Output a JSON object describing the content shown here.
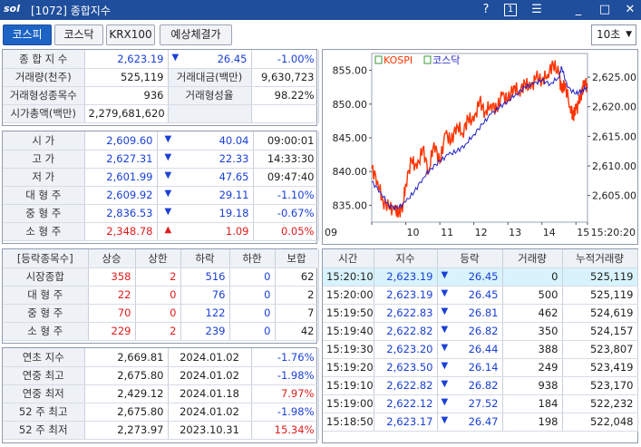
{
  "window": {
    "logo": "sol",
    "title": "[1072] 종합지수",
    "help": "?",
    "one": "1",
    "menu": "☰",
    "minimize": "_",
    "maximize": "□",
    "close": "✕"
  },
  "tabs": [
    {
      "label": "코스피",
      "active": true
    },
    {
      "label": "코스닥",
      "active": false
    },
    {
      "label": "KRX100",
      "active": false
    },
    {
      "label": "예상체결가",
      "active": false
    }
  ],
  "period": {
    "value": "10초",
    "arrow": "▼"
  },
  "summary": {
    "index_label": "종 합 지 수",
    "index_value": "2,623.19",
    "index_arrow": "▼",
    "index_change": "26.45",
    "index_rate": "-1.00%",
    "volume_label": "거래량(천주)",
    "volume_value": "525,119",
    "amount_label": "거래대금(백만)",
    "amount_value": "9,630,723",
    "formed_count_label": "거래형성종목수",
    "formed_count_value": "936",
    "formed_rate_label": "거래형성율",
    "formed_rate_value": "98.22%",
    "mcap_label": "시가총액(백만)",
    "mcap_value": "2,279,681,620"
  },
  "prices": [
    {
      "label": "시      가",
      "value": "2,609.60",
      "arrow": "▼",
      "change": "40.04",
      "extra": "09:00:01",
      "dir": "down",
      "extra_type": "time"
    },
    {
      "label": "고      가",
      "value": "2,627.31",
      "arrow": "▼",
      "change": "22.33",
      "extra": "14:33:30",
      "dir": "down",
      "extra_type": "time"
    },
    {
      "label": "저      가",
      "value": "2,601.99",
      "arrow": "▼",
      "change": "47.65",
      "extra": "09:47:40",
      "dir": "down",
      "extra_type": "time"
    },
    {
      "label": "대 형 주",
      "value": "2,609.92",
      "arrow": "▼",
      "change": "29.11",
      "extra": "-1.10%",
      "dir": "down",
      "extra_type": "rate"
    },
    {
      "label": "중 형 주",
      "value": "2,836.53",
      "arrow": "▼",
      "change": "19.18",
      "extra": "-0.67%",
      "dir": "down",
      "extra_type": "rate"
    },
    {
      "label": "소 형 주",
      "value": "2,348.78",
      "arrow": "▲",
      "change": "1.09",
      "extra": "0.05%",
      "dir": "up",
      "extra_type": "rate"
    }
  ],
  "breadth": {
    "headers": [
      "[등락종목수]",
      "상승",
      "상한",
      "하락",
      "하한",
      "보합"
    ],
    "rows": [
      {
        "label": "시장종합",
        "up": "358",
        "upper": "2",
        "down": "516",
        "lower": "0",
        "flat": "62"
      },
      {
        "label": "대 형 주",
        "up": "22",
        "upper": "0",
        "down": "76",
        "lower": "0",
        "flat": "2"
      },
      {
        "label": "중 형 주",
        "up": "70",
        "upper": "0",
        "down": "122",
        "lower": "0",
        "flat": "7"
      },
      {
        "label": "소 형 주",
        "up": "229",
        "upper": "2",
        "down": "239",
        "lower": "0",
        "flat": "42"
      }
    ]
  },
  "yearly": [
    {
      "label": "연초  지수",
      "value": "2,669.81",
      "date": "2024.01.02",
      "rate": "-1.76%",
      "dir": "down"
    },
    {
      "label": "연중  최고",
      "value": "2,675.80",
      "date": "2024.01.02",
      "rate": "-1.98%",
      "dir": "down"
    },
    {
      "label": "연중  최저",
      "value": "2,429.12",
      "date": "2024.01.18",
      "rate": "7.97%",
      "dir": "up"
    },
    {
      "label": "52 주 최고",
      "value": "2,675.80",
      "date": "2024.01.02",
      "rate": "-1.98%",
      "dir": "down"
    },
    {
      "label": "52 주 최저",
      "value": "2,273.97",
      "date": "2023.10.31",
      "rate": "15.34%",
      "dir": "up"
    }
  ],
  "ticks": {
    "headers": [
      "시간",
      "지수",
      "등락",
      "거래량",
      "누적거래량"
    ],
    "rows": [
      {
        "time": "15:20:10",
        "index": "2,623.19",
        "arrow": "▼",
        "change": "26.45",
        "vol": "0",
        "cum": "525,119",
        "selected": true
      },
      {
        "time": "15:20:00",
        "index": "2,623.19",
        "arrow": "▼",
        "change": "26.45",
        "vol": "500",
        "cum": "525,119",
        "selected": false
      },
      {
        "time": "15:19:50",
        "index": "2,622.83",
        "arrow": "▼",
        "change": "26.81",
        "vol": "462",
        "cum": "524,619",
        "selected": false
      },
      {
        "time": "15:19:40",
        "index": "2,622.82",
        "arrow": "▼",
        "change": "26.82",
        "vol": "350",
        "cum": "524,157",
        "selected": false
      },
      {
        "time": "15:19:30",
        "index": "2,623.20",
        "arrow": "▼",
        "change": "26.44",
        "vol": "388",
        "cum": "523,807",
        "selected": false
      },
      {
        "time": "15:19:20",
        "index": "2,623.50",
        "arrow": "▼",
        "change": "26.14",
        "vol": "249",
        "cum": "523,419",
        "selected": false
      },
      {
        "time": "15:19:10",
        "index": "2,622.82",
        "arrow": "▼",
        "change": "26.82",
        "vol": "938",
        "cum": "523,170",
        "selected": false
      },
      {
        "time": "15:19:00",
        "index": "2,622.12",
        "arrow": "▼",
        "change": "27.52",
        "vol": "184",
        "cum": "522,232",
        "selected": false
      },
      {
        "time": "15:18:50",
        "index": "2,623.17",
        "arrow": "▼",
        "change": "26.47",
        "vol": "198",
        "cum": "522,048",
        "selected": false
      }
    ]
  },
  "chart_data": {
    "type": "line",
    "legend": [
      "KOSPI",
      "코스닥"
    ],
    "left_axis": {
      "ticks": [
        "855.00",
        "850.00",
        "845.00",
        "840.00",
        "835.00"
      ],
      "values": [
        855,
        850,
        845,
        840,
        835
      ],
      "range": [
        832.5,
        857.5
      ]
    },
    "right_axis": {
      "ticks": [
        "2,625.00",
        "2,620.00",
        "2,615.00",
        "2,610.00",
        "2,605.00"
      ],
      "values": [
        2625,
        2620,
        2615,
        2610,
        2605
      ],
      "range": [
        2600.5,
        2629.0
      ]
    },
    "x_ticks": [
      "09",
      "10",
      "11",
      "12",
      "13",
      "14",
      "15",
      "15:20:20"
    ],
    "x_tick_hours": [
      9,
      10,
      11,
      12,
      13,
      14,
      15,
      15.339
    ],
    "x_range": [
      9,
      15.339
    ],
    "series": [
      {
        "name": "KOSPI",
        "axis": "right",
        "color": "#ff3300",
        "x": [
          9.0,
          9.17,
          9.33,
          9.5,
          9.67,
          9.79,
          9.92,
          10.0,
          10.17,
          10.33,
          10.5,
          10.67,
          10.83,
          11.0,
          11.17,
          11.33,
          11.5,
          11.67,
          11.83,
          12.0,
          12.17,
          12.33,
          12.5,
          12.67,
          12.83,
          13.0,
          13.17,
          13.33,
          13.5,
          13.67,
          13.83,
          14.0,
          14.17,
          14.33,
          14.5,
          14.58,
          14.67,
          14.83,
          14.92,
          15.0,
          15.08,
          15.17,
          15.25,
          15.33
        ],
        "y": [
          2609.6,
          2607.5,
          2604.0,
          2603.0,
          2602.5,
          2602.0,
          2603.5,
          2607.0,
          2611.0,
          2609.5,
          2613.0,
          2609.0,
          2614.0,
          2610.5,
          2615.5,
          2614.0,
          2617.0,
          2615.5,
          2618.0,
          2617.5,
          2621.0,
          2619.0,
          2620.5,
          2619.5,
          2622.0,
          2621.0,
          2623.5,
          2622.5,
          2624.0,
          2623.0,
          2625.0,
          2624.5,
          2625.5,
          2627.3,
          2625.5,
          2622.5,
          2624.0,
          2620.0,
          2618.5,
          2619.5,
          2620.5,
          2622.5,
          2624.5,
          2623.19
        ]
      },
      {
        "name": "코스닥",
        "axis": "left",
        "color": "#2020c8",
        "x": [
          9.0,
          9.25,
          9.5,
          9.75,
          10.0,
          10.25,
          10.5,
          10.75,
          11.0,
          11.25,
          11.5,
          11.75,
          12.0,
          12.25,
          12.5,
          12.75,
          13.0,
          13.25,
          13.5,
          13.75,
          14.0,
          14.25,
          14.5,
          14.58,
          14.75,
          15.0,
          15.17,
          15.33
        ],
        "y": [
          838.5,
          837.0,
          835.0,
          834.5,
          835.5,
          837.0,
          839.0,
          840.5,
          841.5,
          842.5,
          843.0,
          844.0,
          845.5,
          847.0,
          848.5,
          849.5,
          850.5,
          851.5,
          852.5,
          853.0,
          853.5,
          853.0,
          854.0,
          855.5,
          852.5,
          851.5,
          852.0,
          852.5
        ]
      }
    ]
  }
}
